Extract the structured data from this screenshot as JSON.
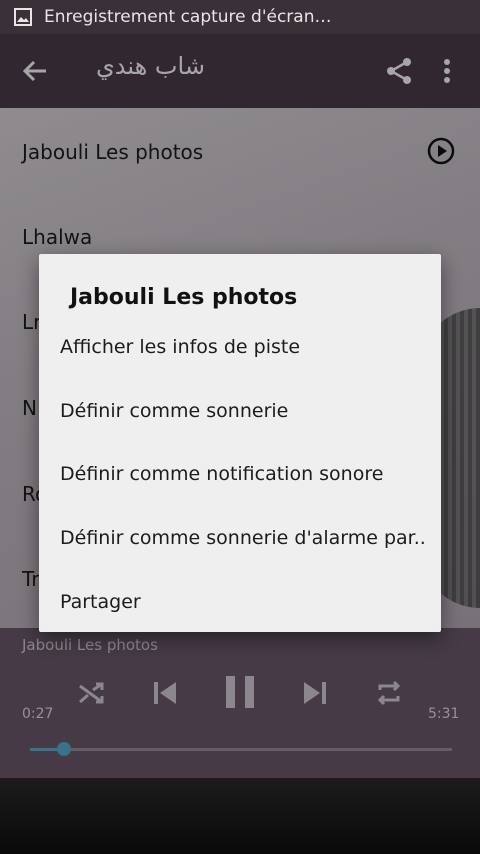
{
  "status_bar": {
    "notification_text": "Enregistrement capture d'écran…",
    "icon": "image-icon"
  },
  "app_bar": {
    "title": "شاب هندي",
    "back_icon": "arrow-left-icon",
    "share_icon": "share-icon",
    "more_icon": "more-vert-icon"
  },
  "tracks": [
    {
      "label": "Jabouli Les photos"
    },
    {
      "label": "Lhalwa"
    },
    {
      "label": "Lr"
    },
    {
      "label": "N"
    },
    {
      "label": "Ro"
    },
    {
      "label": "Tr"
    }
  ],
  "dialog": {
    "title": "Jabouli Les photos",
    "items": [
      {
        "label": "Afficher les infos de piste"
      },
      {
        "label": "Définir comme sonnerie"
      },
      {
        "label": "Définir comme notification sonore"
      },
      {
        "label": "Définir comme sonnerie d'alarme par.."
      },
      {
        "label": "Partager"
      }
    ]
  },
  "player": {
    "now_playing": "Jabouli Les photos",
    "elapsed": "0:27",
    "duration": "5:31",
    "progress_fraction": 0.081,
    "controls": [
      "shuffle-icon",
      "previous-icon",
      "pause-icon",
      "next-icon",
      "repeat-icon"
    ]
  },
  "colors": {
    "app_bar": "#4a3d4c",
    "player_panel": "#6a5a6b",
    "progress": "#5ab0d8",
    "dialog_bg": "#efefef"
  }
}
